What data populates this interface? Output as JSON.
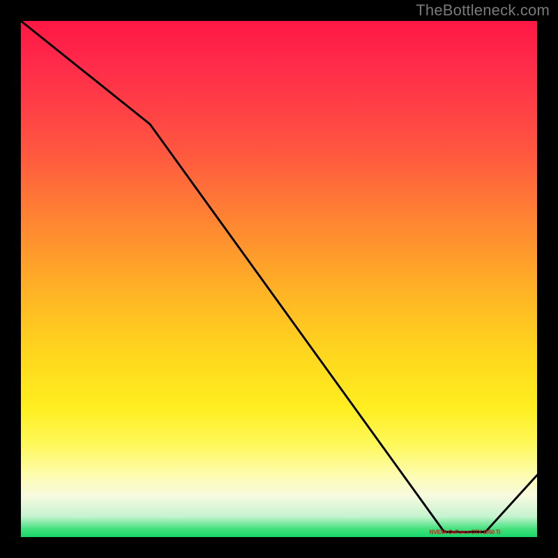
{
  "attribution": "TheBottleneck.com",
  "chart_data": {
    "type": "line",
    "title": "",
    "xlabel": "",
    "ylabel": "",
    "xlim": [
      0,
      100
    ],
    "ylim": [
      0,
      100
    ],
    "x": [
      0,
      25,
      82,
      90,
      100
    ],
    "values": [
      100,
      80,
      1,
      1,
      12
    ],
    "annotation": {
      "text": "NVIDIA GeForce GTX 1050 Ti",
      "x": 86,
      "y": 1
    },
    "background_gradient": {
      "stops": [
        {
          "pct": 0,
          "color": "#ff1744"
        },
        {
          "pct": 50,
          "color": "#ffb224"
        },
        {
          "pct": 80,
          "color": "#fff85a"
        },
        {
          "pct": 96,
          "color": "#c6f3d0"
        },
        {
          "pct": 100,
          "color": "#18d56a"
        }
      ]
    }
  }
}
